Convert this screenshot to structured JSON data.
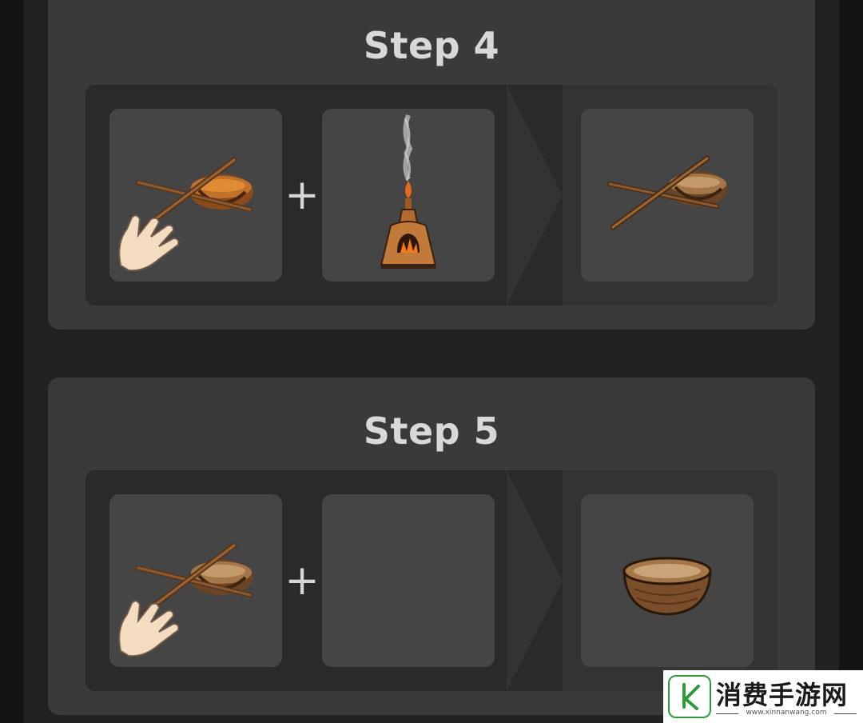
{
  "steps": [
    {
      "title": "Step 4",
      "inputs": [
        {
          "item": "fire-drill-with-hand-icon"
        },
        {
          "item": "kiln-icon"
        }
      ],
      "plus_label": "+",
      "output": {
        "item": "fire-drill-icon"
      }
    },
    {
      "title": "Step 5",
      "inputs": [
        {
          "item": "fire-drill-with-hand-icon"
        },
        {
          "item": "empty-slot"
        }
      ],
      "plus_label": "+",
      "output": {
        "item": "fired-bowl-icon"
      }
    }
  ],
  "watermark": {
    "title": "消费手游网",
    "url": "www.xinnanwang.com",
    "brand_color": "#2e9a3a"
  },
  "colors": {
    "card": "#3a3a3a",
    "panel": "#2a2a2a",
    "slot": "#454545",
    "title_text": "#d8d8d8"
  }
}
